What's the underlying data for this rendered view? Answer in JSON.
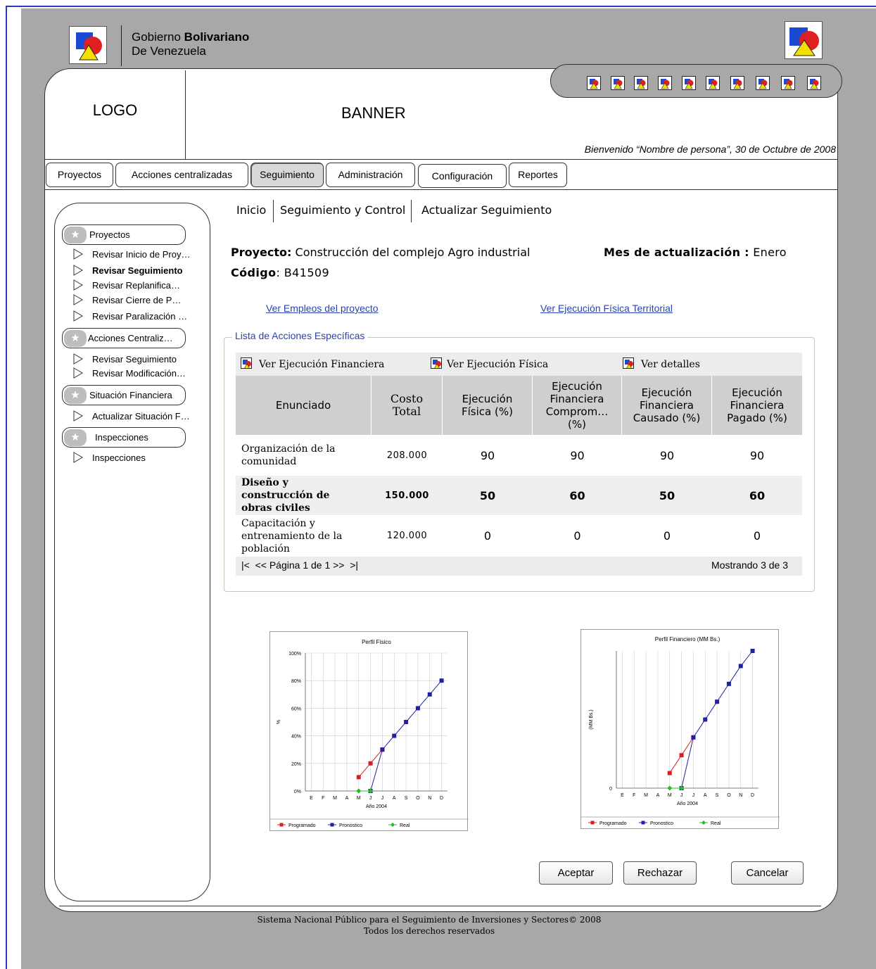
{
  "header": {
    "gov_line1_prefix": "Gobierno",
    "gov_line1_bold": "Bolivariano",
    "gov_line2": "De Venezuela",
    "logo": "LOGO",
    "banner": "BANNER",
    "welcome": "Bienvenido “Nombre de persona”, 30 de Octubre de 2008"
  },
  "nav": {
    "tabs": [
      "Proyectos",
      "Acciones centralizadas",
      "Seguimiento",
      "Administración",
      "Configuración",
      "Reportes"
    ],
    "active": "Seguimiento"
  },
  "sidebar": {
    "groups": [
      {
        "label": "Proyectos",
        "items": [
          "Revisar Inicio de Proy…",
          "Revisar Seguimiento",
          "Revisar Replanifica…",
          "Revisar Cierre de P…",
          "Revisar Paralización …"
        ]
      },
      {
        "label": "Acciones Centraliz…",
        "items": [
          "Revisar Seguimiento",
          "Revisar Modificación…"
        ]
      },
      {
        "label": "Situación Financiera",
        "items": [
          "Actualizar Situación F…"
        ]
      },
      {
        "label": "Inspecciones",
        "items": [
          "Inspecciones"
        ]
      }
    ],
    "selected_item": "Revisar Seguimiento"
  },
  "breadcrumb": [
    "Inicio",
    "Seguimiento y Control",
    "Actualizar Seguimiento"
  ],
  "project": {
    "name_label": "Proyecto:",
    "name": "Construcción del complejo Agro industrial",
    "month_label": "Mes de actualización :",
    "month": "Enero",
    "code_label": "Código",
    "code": ": B41509"
  },
  "links": {
    "employment": "Ver Empleos del proyecto",
    "territorial": "Ver Ejecución Física Territorial"
  },
  "actions_list": {
    "legend": "Lista de Acciones Específicas",
    "toolbar": [
      "Ver Ejecución Financiera",
      "Ver Ejecución Física",
      "Ver detalles"
    ],
    "columns": [
      "Enunciado",
      "Costo Total",
      "Ejecución Física (%)",
      "Ejecución Financiera Comprom… (%)",
      "Ejecución Financiera Causado (%)",
      "Ejecución Financiera Pagado (%)"
    ],
    "rows": [
      {
        "name": "Organización de la comunidad",
        "cost": "208.000",
        "fisica": "90",
        "comprom": "90",
        "causado": "90",
        "pagado": "90"
      },
      {
        "name": "Diseño y construcción de obras civiles",
        "cost": "150.000",
        "fisica": "50",
        "comprom": "60",
        "causado": "50",
        "pagado": "60"
      },
      {
        "name": "Capacitación y entrenamiento de la población",
        "cost": "120.000",
        "fisica": "0",
        "comprom": "0",
        "causado": "0",
        "pagado": "0"
      }
    ],
    "pager": "|<  << Página 1 de 1 >>  >|",
    "showing": "Mostrando 3 de 3"
  },
  "chart_data": [
    {
      "type": "line",
      "title": "Perfil Físico",
      "xlabel": "Año 2004",
      "ylabel": "%",
      "categories": [
        "E",
        "F",
        "M",
        "A",
        "M",
        "J",
        "J",
        "A",
        "S",
        "O",
        "N",
        "D"
      ],
      "yticks": [
        "0%",
        "20%",
        "40%",
        "60%",
        "80%",
        "100%"
      ],
      "ylim": [
        0,
        100
      ],
      "grid": true,
      "legend_position": "bottom",
      "series": [
        {
          "name": "Programado",
          "color": "#d42020",
          "values": [
            null,
            null,
            null,
            null,
            10,
            20,
            30,
            null,
            null,
            null,
            null,
            null
          ]
        },
        {
          "name": "Pronostico",
          "color": "#2020a0",
          "values": [
            null,
            null,
            null,
            null,
            null,
            0,
            30,
            40,
            50,
            60,
            70,
            80
          ]
        },
        {
          "name": "Real",
          "color": "#20c020",
          "values": [
            null,
            null,
            null,
            null,
            0,
            0,
            null,
            null,
            null,
            null,
            null,
            null
          ]
        }
      ]
    },
    {
      "type": "line",
      "title": "Perfil Financiero (MM Bs.)",
      "xlabel": "Año 2004",
      "ylabel": "(MM Bs.)",
      "categories": [
        "E",
        "F",
        "M",
        "A",
        "M",
        "J",
        "J",
        "A",
        "S",
        "O",
        "N",
        "D"
      ],
      "yticks": [
        "0"
      ],
      "ylim": [
        0,
        100
      ],
      "grid": true,
      "legend_position": "bottom",
      "series": [
        {
          "name": "Programado",
          "color": "#d42020",
          "values": [
            null,
            null,
            null,
            null,
            11,
            24,
            37,
            null,
            null,
            null,
            null,
            null
          ]
        },
        {
          "name": "Pronostico",
          "color": "#2020a0",
          "values": [
            null,
            null,
            null,
            null,
            null,
            0,
            37,
            50,
            63,
            76,
            89,
            100
          ]
        },
        {
          "name": "Real",
          "color": "#20c020",
          "values": [
            null,
            null,
            null,
            null,
            0,
            0,
            null,
            null,
            null,
            null,
            null,
            null
          ]
        }
      ]
    }
  ],
  "buttons": {
    "accept": "Aceptar",
    "reject": "Rechazar",
    "cancel": "Cancelar"
  },
  "footer": {
    "line1": "Sistema Nacional Público para el Seguimiento de Inversiones y Sectores© 2008",
    "line2": "Todos los derechos reservados"
  },
  "colors": {
    "link": "#2a42b0",
    "frame": "#2040c0",
    "background": "#a8a8a8"
  },
  "icons": {
    "app_logo": "blue-square-red-circle-yellow-triangle-icon"
  }
}
